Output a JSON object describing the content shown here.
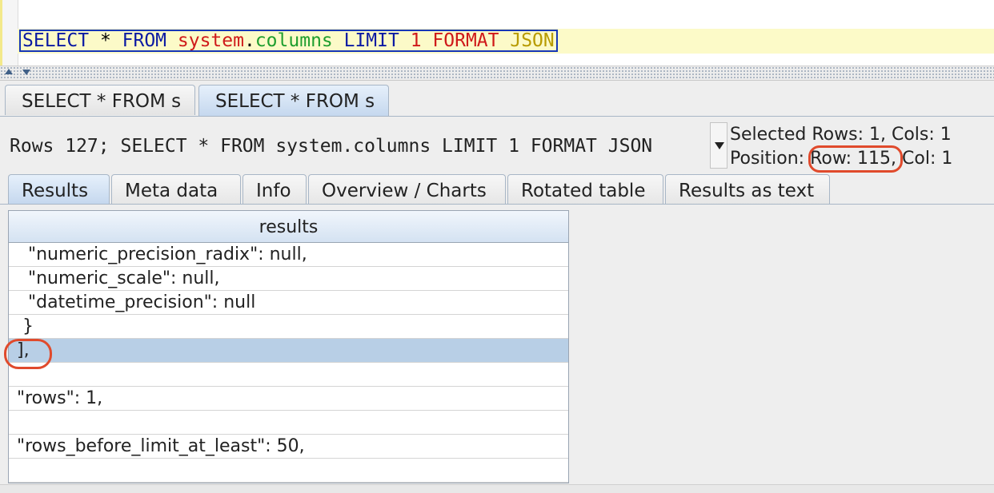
{
  "editor": {
    "query_tokens": [
      {
        "text": "SELECT",
        "cls": "kw"
      },
      {
        "text": " * ",
        "cls": "op"
      },
      {
        "text": "FROM",
        "cls": "kw"
      },
      {
        "text": " system",
        "cls": "tbl"
      },
      {
        "text": ".",
        "cls": "op"
      },
      {
        "text": "columns",
        "cls": "col"
      },
      {
        "text": " LIMIT",
        "cls": "kw"
      },
      {
        "text": " 1",
        "cls": "num"
      },
      {
        "text": " FORMAT",
        "cls": "tbl"
      },
      {
        "text": " JSON",
        "cls": "fmt"
      }
    ]
  },
  "query_tabs": [
    {
      "label": "SELECT * FROM s",
      "active": false
    },
    {
      "label": "SELECT * FROM s",
      "active": true
    }
  ],
  "result_info": {
    "rows_summary": "Rows 127;  SELECT * FROM system.columns LIMIT 1 FORMAT JSON",
    "selected_text": "Selected Rows: 1, Cols: 1",
    "position_prefix": "Position: ",
    "position_row": "Row: 115",
    "position_suffix": ", Col: 1"
  },
  "result_tabs": [
    {
      "label": "Results",
      "active": true
    },
    {
      "label": "Meta data",
      "active": false
    },
    {
      "label": "Info",
      "active": false
    },
    {
      "label": "Overview / Charts",
      "active": false
    },
    {
      "label": "Rotated table",
      "active": false
    },
    {
      "label": "Results as text",
      "active": false
    }
  ],
  "results": {
    "header": "results",
    "rows": [
      "  \"numeric_precision_radix\": null,",
      "  \"numeric_scale\": null,",
      "  \"datetime_precision\": null",
      " }",
      "],",
      "",
      "\"rows\": 1,",
      "",
      "\"rows_before_limit_at_least\": 50,",
      ""
    ],
    "selected_row_index": 4
  },
  "colors": {
    "keyword": "#0b1aa3",
    "table": "#cf1a1a",
    "column": "#1e9e2e",
    "format": "#b89b00",
    "selection": "#b8cfe6",
    "annotation": "#e04a2c"
  }
}
